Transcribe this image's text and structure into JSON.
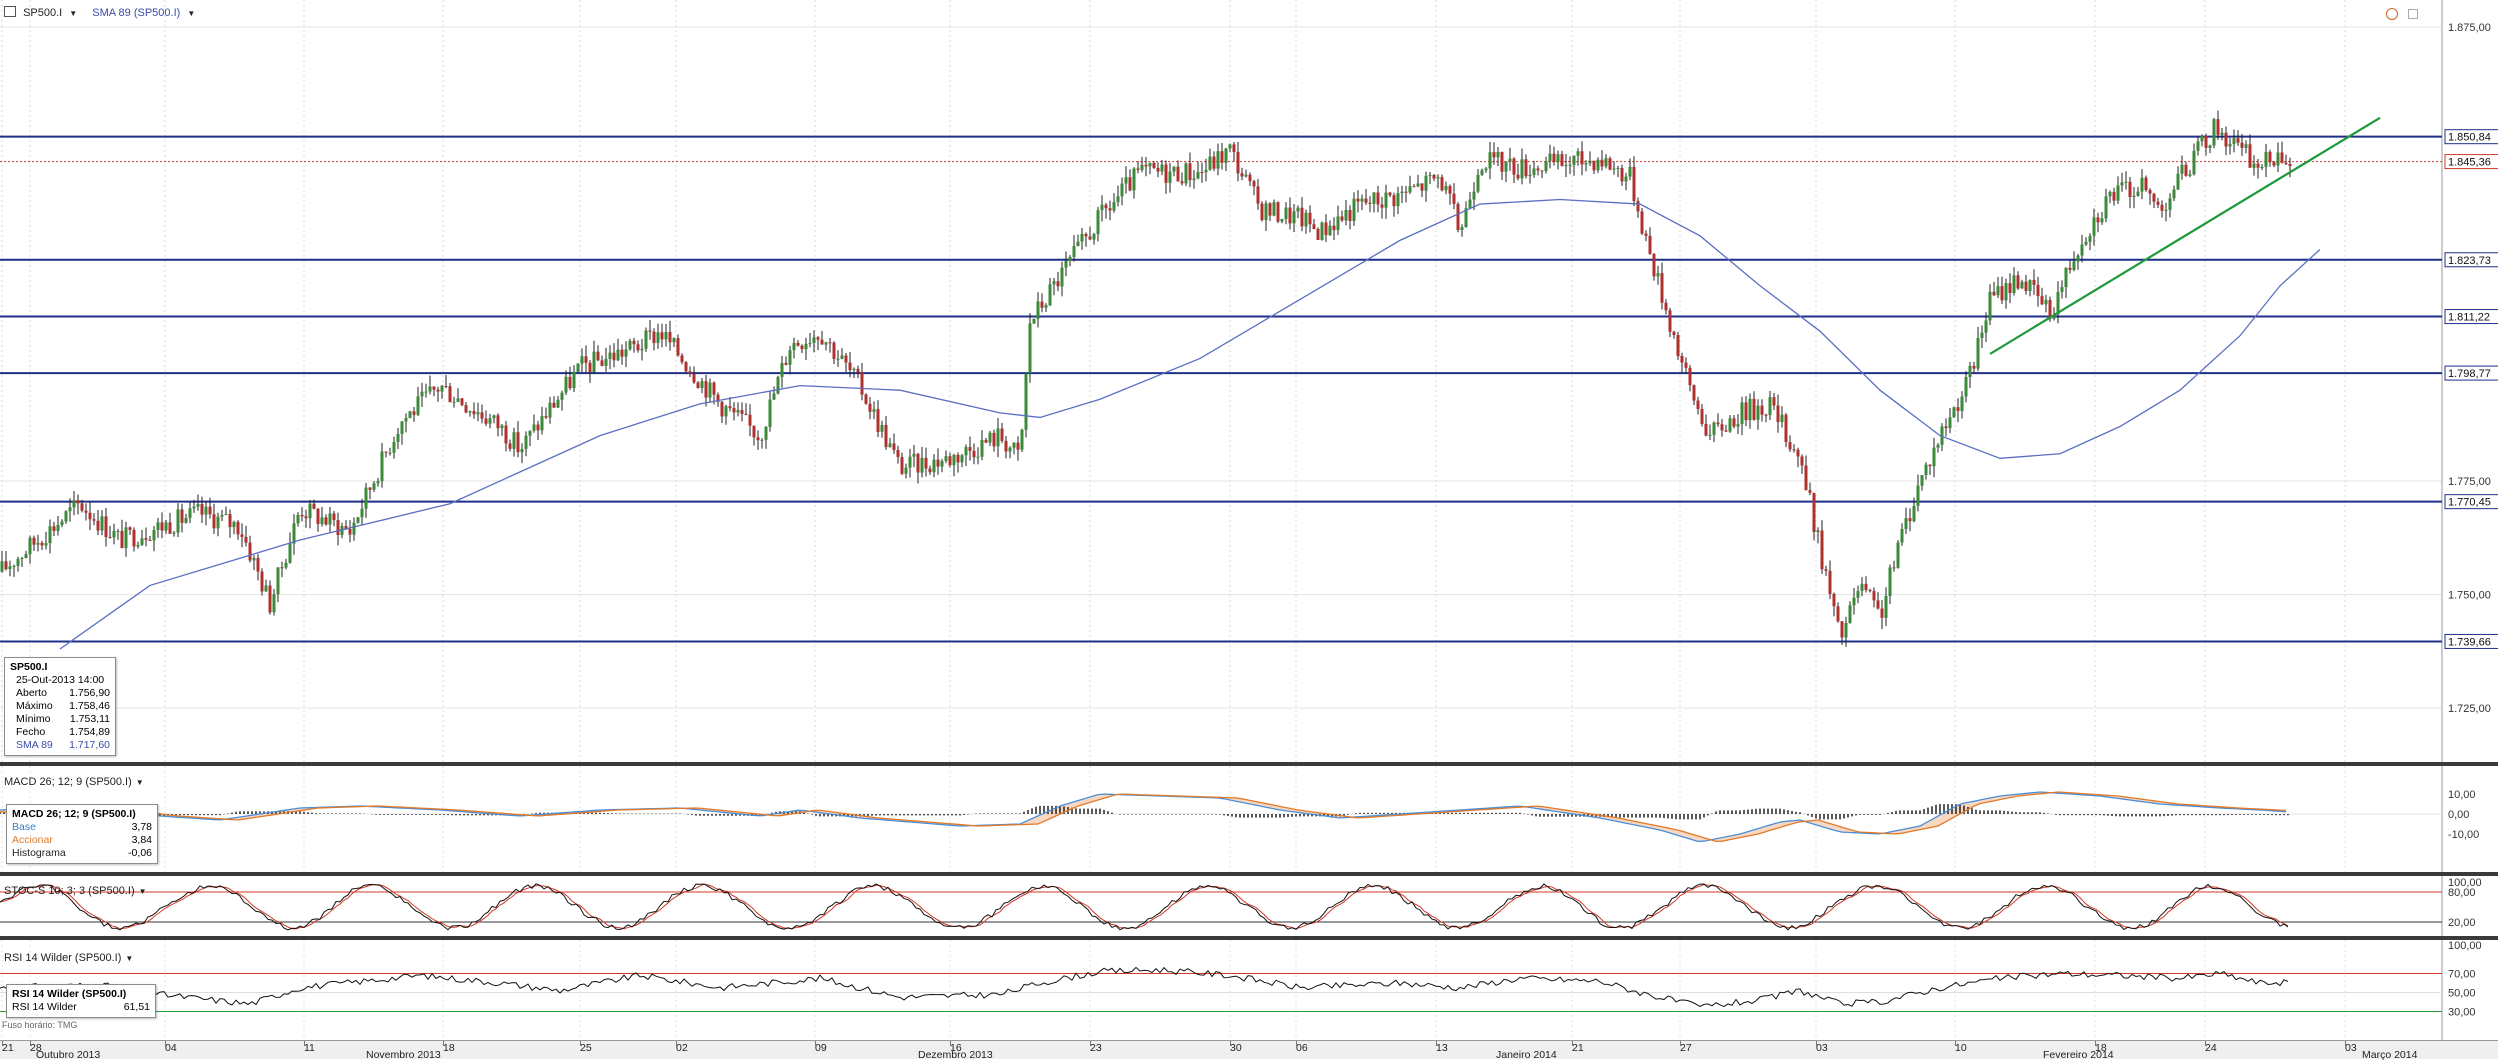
{
  "main": {
    "symbol": "SP500.I",
    "indicator": "SMA 89 (SP500.I)",
    "yticks": [
      {
        "label": "1.875,00",
        "v": 1875
      },
      {
        "label": "1.775,00",
        "v": 1775
      },
      {
        "label": "1.750,00",
        "v": 1750
      },
      {
        "label": "1.725,00",
        "v": 1725
      }
    ],
    "hlines": [
      {
        "label": "1.850,84",
        "v": 1850.84
      },
      {
        "label": "1.823,73",
        "v": 1823.73
      },
      {
        "label": "1.811,22",
        "v": 1811.22
      },
      {
        "label": "1.798,77",
        "v": 1798.77
      },
      {
        "label": "1.770,45",
        "v": 1770.45
      },
      {
        "label": "1.739,66",
        "v": 1739.66
      }
    ],
    "last_price": {
      "label": "1.845,36",
      "v": 1845.36
    },
    "colors": {
      "hline": "#1f2f8a",
      "last": "#d23a2a",
      "sma": "#5b6fc2",
      "trend": "#1e9a3a",
      "up": "#3a8a3a",
      "down": "#b03030"
    }
  },
  "tooltip": {
    "title": "SP500.I",
    "date": "25-Out-2013 14:00",
    "rows": [
      {
        "k": "Aberto",
        "v": "1.756,90"
      },
      {
        "k": "Máximo",
        "v": "1.758,46"
      },
      {
        "k": "Mínimo",
        "v": "1.753,11"
      },
      {
        "k": "Fecho",
        "v": "1.754,89"
      },
      {
        "k": "SMA 89",
        "v": "1.717,60"
      }
    ]
  },
  "macd": {
    "header": "MACD 26; 12; 9 (SP500.I)",
    "title": "MACD 26; 12; 9 (SP500.I)",
    "rows": [
      {
        "k": "Base",
        "v": "3,78",
        "color": "#3a7cc8"
      },
      {
        "k": "Accionar",
        "v": "3,84",
        "color": "#e07a2a"
      },
      {
        "k": "Histograma",
        "v": "-0,06",
        "color": "#222"
      }
    ],
    "yticks": [
      "10,00",
      "0,00",
      "-10,00"
    ]
  },
  "stoc": {
    "header": "STOC-S 10; 3; 3 (SP500.I)",
    "yticks": [
      "100,00",
      "80,00",
      "20,00"
    ]
  },
  "rsi": {
    "header": "RSI 14 Wilder (SP500.I)",
    "title": "RSI 14 Wilder (SP500.I)",
    "value_label": "RSI 14 Wilder",
    "value": "61,51",
    "yticks": [
      "100,00",
      "70,00",
      "50,00",
      "30,00"
    ],
    "timezone": "Fuso horário: TMG"
  },
  "xaxis": {
    "days": [
      {
        "t": "21",
        "x": 2
      },
      {
        "t": "28",
        "x": 30
      },
      {
        "t": "04",
        "x": 165
      },
      {
        "t": "11",
        "x": 304
      },
      {
        "t": "18",
        "x": 443
      },
      {
        "t": "25",
        "x": 580
      },
      {
        "t": "02",
        "x": 676
      },
      {
        "t": "09",
        "x": 815
      },
      {
        "t": "16",
        "x": 950
      },
      {
        "t": "23",
        "x": 1090
      },
      {
        "t": "30",
        "x": 1230
      },
      {
        "t": "06",
        "x": 1296
      },
      {
        "t": "13",
        "x": 1436
      },
      {
        "t": "21",
        "x": 1572
      },
      {
        "t": "27",
        "x": 1680
      },
      {
        "t": "03",
        "x": 1816
      },
      {
        "t": "10",
        "x": 1955
      },
      {
        "t": "18",
        "x": 2095
      },
      {
        "t": "24",
        "x": 2205
      },
      {
        "t": "03",
        "x": 2345
      }
    ],
    "months": [
      {
        "t": "Outubro 2013",
        "x": 36
      },
      {
        "t": "Novembro 2013",
        "x": 366
      },
      {
        "t": "Dezembro 2013",
        "x": 918
      },
      {
        "t": "Janeiro 2014",
        "x": 1496
      },
      {
        "t": "Fevereiro 2014",
        "x": 2043
      },
      {
        "t": "Março 2014",
        "x": 2362
      }
    ]
  }
}
